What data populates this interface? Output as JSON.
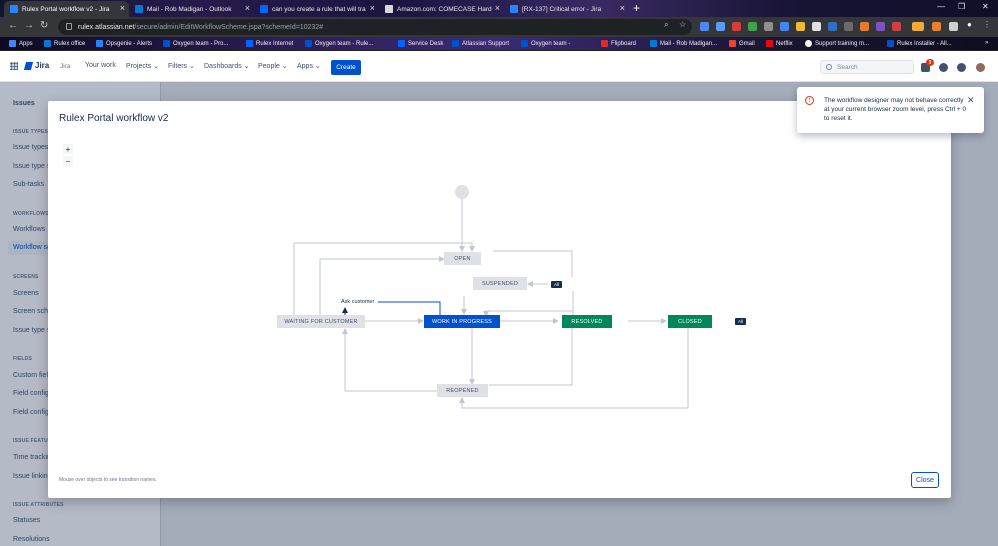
{
  "browser": {
    "tabs": [
      {
        "title": "Rulex Portal workflow v2 - Jira",
        "color": "#2684ff",
        "active": true
      },
      {
        "title": "Mail - Rob Madigan - Outlook",
        "color": "#0078d4",
        "active": false
      },
      {
        "title": "can you create a rule that will tra",
        "color": "#0065ff",
        "active": false
      },
      {
        "title": "Amazon.com: COMECASE Hard",
        "color": "#d9d9d9",
        "active": false
      },
      {
        "title": "[RX-137] Critical error - Jira",
        "color": "#2684ff",
        "active": false
      }
    ],
    "url_host": "rulex.atlassian.net",
    "url_path": "/secure/admin/EditWorkflowScheme.jspa?schemeId=10232#",
    "bookmarks": [
      {
        "label": "Apps",
        "color": "#4285f4"
      },
      {
        "label": "Rulex office",
        "color": "#0078d4"
      },
      {
        "label": "Opsgenie - Alerts",
        "color": "#2684ff"
      },
      {
        "label": "Oxygen team - Pro...",
        "color": "#0052cc"
      },
      {
        "label": "Rulex Internet",
        "color": "#0065ff"
      },
      {
        "label": "Oxygen team - Rule...",
        "color": "#0052cc"
      },
      {
        "label": "Service Desk",
        "color": "#0065ff"
      },
      {
        "label": "Atlassian Support",
        "color": "#0052cc"
      },
      {
        "label": "Oxygen team -",
        "color": "#0052cc"
      },
      {
        "label": "Flipboard",
        "color": "#e12828"
      },
      {
        "label": "Mail - Rob Madigan...",
        "color": "#0078d4"
      },
      {
        "label": "Gmail",
        "color": "#ea4335"
      },
      {
        "label": "Netflix",
        "color": "#e50914"
      },
      {
        "label": "Support training m...",
        "color": "#ffffff"
      },
      {
        "label": "Rulex Installer - All...",
        "color": "#0052cc"
      }
    ]
  },
  "header": {
    "logo": "Jira",
    "product": "Jira",
    "nav": [
      "Your work",
      "Projects",
      "Filters",
      "Dashboards",
      "People",
      "Apps"
    ],
    "create": "Create",
    "search_placeholder": "Search",
    "notification_count": "9"
  },
  "sidebar": {
    "title": "Issues",
    "sections": [
      {
        "heading": "ISSUE TYPES",
        "items": [
          "Issue types",
          "Issue type s",
          "Sub-tasks"
        ]
      },
      {
        "heading": "WORKFLOWS",
        "items": [
          "Workflows",
          "Workflow sc"
        ]
      },
      {
        "heading": "SCREENS",
        "items": [
          "Screens",
          "Screen sche",
          "Issue type s"
        ]
      },
      {
        "heading": "FIELDS",
        "items": [
          "Custom field",
          "Field config",
          "Field config"
        ]
      },
      {
        "heading": "ISSUE FEATURES",
        "items": [
          "Time trackin",
          "Issue linkin"
        ]
      },
      {
        "heading": "ISSUE ATTRIBUTES",
        "items": [
          "Statuses",
          "Resolutions"
        ]
      }
    ]
  },
  "dialog": {
    "title": "Rulex Portal workflow v2",
    "zoom_in": "+",
    "zoom_out": "−",
    "hint": "Mouse over objects to see transition names.",
    "close": "Close",
    "statuses": {
      "open": "OPEN",
      "suspended": "SUSPENDED",
      "waiting": "WAITING FOR CUSTOMER",
      "in_progress": "WORK IN PROGRESS",
      "resolved": "RESOLVED",
      "closed": "CLOSED",
      "reopened": "REOPENED"
    },
    "transition_label": "Ask customer",
    "all_badge": "All"
  },
  "flag": {
    "message": "The workflow designer may not behave correctly at your current browser zoom level, press Ctrl + 0 to reset it.",
    "close": "✕"
  }
}
